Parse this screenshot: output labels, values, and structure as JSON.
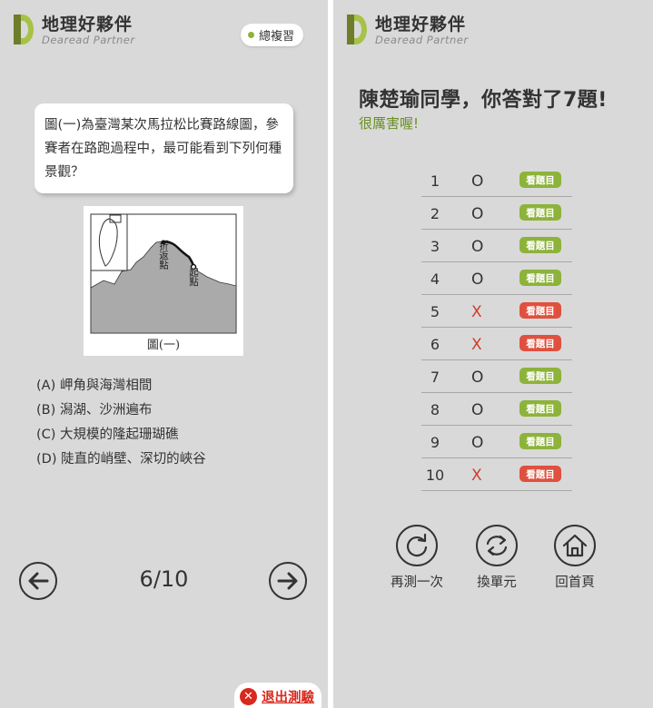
{
  "app": {
    "title": "地理好夥伴",
    "subtitle": "Dearead Partner"
  },
  "quiz": {
    "review_label": "總複習",
    "question": "圖(一)為臺灣某次馬拉松比賽路線圖，參賽者在路跑過程中，最可能看到下列何種景觀？",
    "figure": {
      "caption": "圖(一)",
      "turn_label": "折返點",
      "start_label": "起點"
    },
    "options": [
      "(A) 岬角與海灣相間",
      "(B) 潟湖、沙洲遍布",
      "(C) 大規模的隆起珊瑚礁",
      "(D) 陡直的峭壁、深切的峽谷"
    ],
    "counter": "6/10",
    "exit_label": "退出測驗"
  },
  "result": {
    "title": "陳楚瑜同學，你答對了7題!",
    "subtitle": "很厲害喔!",
    "view_label": "看題目",
    "rows": [
      {
        "num": "1",
        "mark": "O",
        "correct": true
      },
      {
        "num": "2",
        "mark": "O",
        "correct": true
      },
      {
        "num": "3",
        "mark": "O",
        "correct": true
      },
      {
        "num": "4",
        "mark": "O",
        "correct": true
      },
      {
        "num": "5",
        "mark": "X",
        "correct": false
      },
      {
        "num": "6",
        "mark": "X",
        "correct": false
      },
      {
        "num": "7",
        "mark": "O",
        "correct": true
      },
      {
        "num": "8",
        "mark": "O",
        "correct": true
      },
      {
        "num": "9",
        "mark": "O",
        "correct": true
      },
      {
        "num": "10",
        "mark": "X",
        "correct": false
      }
    ],
    "actions": {
      "retest": "再測一次",
      "switch_unit": "換單元",
      "home": "回首頁"
    }
  },
  "colors": {
    "accent_green": "#8db33a",
    "wrong_red": "#e0503e",
    "exit_red": "#d9281c",
    "panel_bg": "#d9d9d9"
  },
  "icons": {
    "prev": "arrow-left-icon",
    "next": "arrow-right-icon",
    "exit": "close-circle-icon",
    "retest": "refresh-icon",
    "switch_unit": "sync-icon",
    "home": "home-icon"
  }
}
